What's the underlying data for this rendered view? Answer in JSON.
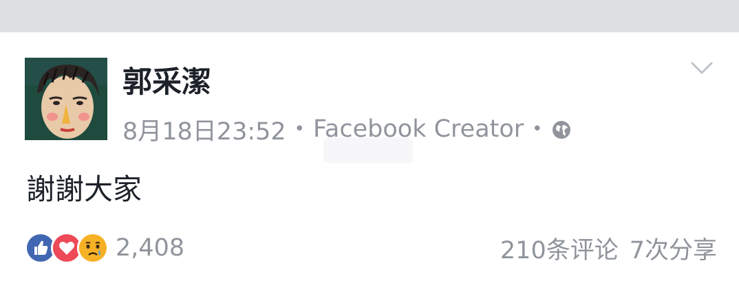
{
  "post": {
    "author": "郭采潔",
    "date": "8月18日23:52",
    "separator": "•",
    "app": "Facebook Creator",
    "privacy_icon": "globe-icon",
    "menu_icon": "chevron-down-icon",
    "text": "謝謝大家"
  },
  "reactions": {
    "icons": [
      "like-icon",
      "love-icon",
      "sad-icon"
    ],
    "count": "2,408"
  },
  "stats": {
    "comments": "210条评论",
    "shares": "7次分享"
  },
  "colors": {
    "top_bar": "#dddfe2",
    "text_primary": "#1d2129",
    "text_secondary": "#90949c",
    "like_blue": "#4267b2",
    "love_red": "#ed4956",
    "sad_yellow": "#f7b125"
  }
}
